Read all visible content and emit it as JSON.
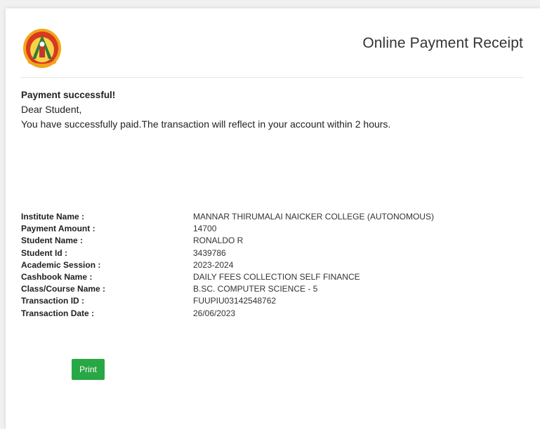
{
  "header": {
    "title": "Online Payment Receipt",
    "logo_icon": "college-emblem-icon"
  },
  "message": {
    "status": "Payment successful!",
    "greeting": "Dear Student,",
    "body": "You have successfully paid.The transaction will reflect in your account within 2 hours."
  },
  "details": {
    "institute": {
      "label": "Institute Name :",
      "value": "MANNAR THIRUMALAI NAICKER COLLEGE (AUTONOMOUS)"
    },
    "amount": {
      "label": "Payment Amount :",
      "value": "14700"
    },
    "student_name": {
      "label": "Student Name :",
      "value": "RONALDO R"
    },
    "student_id": {
      "label": "Student Id :",
      "value": "3439786"
    },
    "session": {
      "label": "Academic Session :",
      "value": "2023-2024"
    },
    "cashbook": {
      "label": "Cashbook Name :",
      "value": "DAILY FEES COLLECTION SELF FINANCE"
    },
    "course": {
      "label": "Class/Course Name :",
      "value": "B.SC. COMPUTER SCIENCE - 5"
    },
    "txn_id": {
      "label": "Transaction ID :",
      "value": "FUUPIU03142548762"
    },
    "txn_date": {
      "label": "Transaction Date :",
      "value": "26/06/2023"
    }
  },
  "actions": {
    "print_label": "Print",
    "print_color": "#28a745"
  }
}
